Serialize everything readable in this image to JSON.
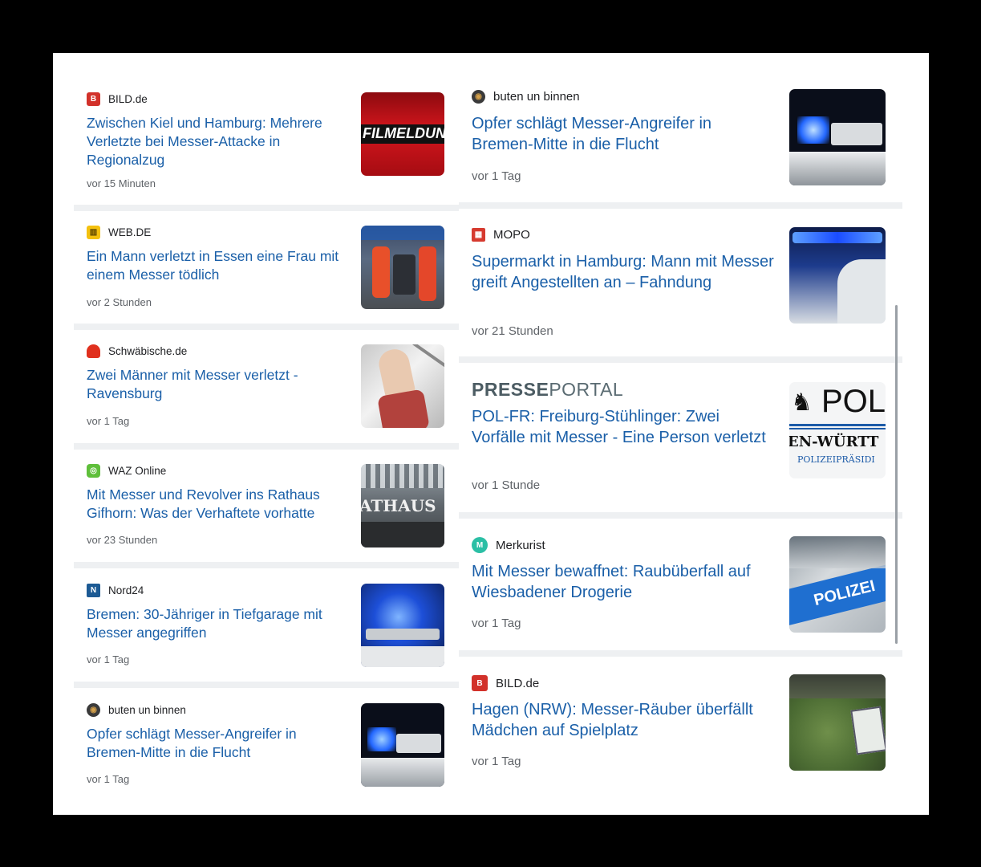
{
  "left_column": [
    {
      "source": "BILD.de",
      "title": "Zwischen Kiel und Hamburg: Mehrere Verletzte bei Messer-Attacke in Regionalzug",
      "time": "vor 15 Minuten",
      "logo_icon": "bild-logo-icon",
      "logo_color": "#d2312a",
      "thumb_text": "FILMELDUN"
    },
    {
      "source": "WEB.DE",
      "title": "Ein Mann verletzt in Essen eine Frau mit einem Messer tödlich",
      "time": "vor 2 Stunden",
      "logo_icon": "webde-logo-icon",
      "logo_color": "#f4c10f"
    },
    {
      "source": "Schwäbische.de",
      "title": "Zwei Männer mit Messer verletzt - Ravensburg",
      "time": "vor 1 Tag",
      "logo_icon": "schwaebische-logo-icon",
      "logo_color": "#e0301e"
    },
    {
      "source": "WAZ Online",
      "title": "Mit Messer und Revolver ins Rathaus Gifhorn: Was der Verhaftete vorhatte",
      "time": "vor 23 Stunden",
      "logo_icon": "waz-logo-icon",
      "logo_color": "#5fbf3a",
      "thumb_text": "ATHAUS"
    },
    {
      "source": "Nord24",
      "title": "Bremen: 30-Jähriger in Tiefgarage mit Messer angegriffen",
      "time": "vor 1 Tag",
      "logo_icon": "nord24-logo-icon",
      "logo_color": "#1c5a94"
    },
    {
      "source": "buten un binnen",
      "title": "Opfer schlägt Messer-Angreifer in Bremen-Mitte in die Flucht",
      "time": "vor 1 Tag",
      "logo_icon": "butenunbinnen-logo-icon",
      "logo_color": "#3a3a3a"
    }
  ],
  "right_column": [
    {
      "source": "buten un binnen",
      "title": "Opfer schlägt Messer-Angreifer in Bremen-Mitte in die Flucht",
      "time": "vor 1 Tag",
      "logo_icon": "butenunbinnen-logo-icon",
      "logo_color": "#3a3a3a"
    },
    {
      "source": "MOPO",
      "title": "Supermarkt in Hamburg: Mann mit Messer greift Angestellten an – Fahndung",
      "time": "vor 21 Stunden",
      "logo_icon": "mopo-logo-icon",
      "logo_color": "#d63a2f"
    },
    {
      "source_logo_bold": "PRESSE",
      "source_logo_light": "PORTAL",
      "title": "POL-FR: Freiburg-Stühlinger: Zwei Vorfälle mit Messer - Eine Person verletzt",
      "time": "vor 1 Stunde",
      "thumb_line1": "POL",
      "thumb_line2": "EN-WÜRTT",
      "thumb_line3": "POLIZEIPRÄSIDI"
    },
    {
      "source": "Merkurist",
      "title": "Mit Messer bewaffnet: Raubüberfall auf Wiesbadener Drogerie",
      "time": "vor 1 Tag",
      "logo_icon": "merkurist-logo-icon",
      "logo_color": "#2bbfa5",
      "thumb_text": "POLIZEI"
    },
    {
      "source": "BILD.de",
      "title": "Hagen (NRW): Messer-Räuber überfällt Mädchen auf Spielplatz",
      "time": "vor 1 Tag",
      "logo_icon": "bild-logo-icon",
      "logo_color": "#d2312a"
    }
  ]
}
